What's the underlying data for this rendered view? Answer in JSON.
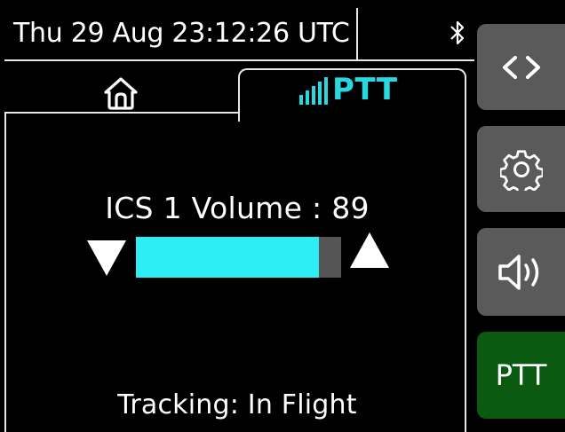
{
  "status": {
    "datetime": "Thu 29 Aug 23:12:26 UTC",
    "bluetooth_icon": "bluetooth-icon"
  },
  "tabs": {
    "home_icon": "home-icon",
    "ptt_label": "PTT",
    "ptt_icon": "signal-bars-icon",
    "accent_color": "#28d8e0"
  },
  "volume": {
    "label": "ICS 1 Volume : 89",
    "value": 89,
    "max": 100,
    "fill_color": "#2eeef5",
    "track_color": "#555555"
  },
  "tracking": {
    "label": "Tracking: In Flight"
  },
  "side_buttons": {
    "code_icon": "code-brackets-icon",
    "settings_icon": "gear-icon",
    "audio_icon": "speaker-icon",
    "ptt_label": "PTT",
    "ptt_color": "#0a5a12",
    "button_color": "#5a5a5a"
  }
}
